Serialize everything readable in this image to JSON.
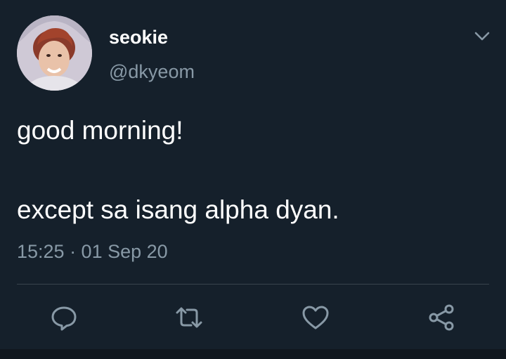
{
  "user": {
    "display_name": "seokie",
    "handle": "@dkyeom"
  },
  "tweet": {
    "line1": "good morning!",
    "line2": "except sa isang alpha dyan.",
    "timestamp": "15:25 · 01 Sep 20"
  },
  "icons": {
    "menu": "chevron-down-icon",
    "reply": "reply-icon",
    "retweet": "retweet-icon",
    "like": "heart-icon",
    "share": "share-icon"
  },
  "colors": {
    "background": "#15202b",
    "primary_text": "#ffffff",
    "secondary_text": "#8899a6",
    "divider": "#38444d"
  }
}
